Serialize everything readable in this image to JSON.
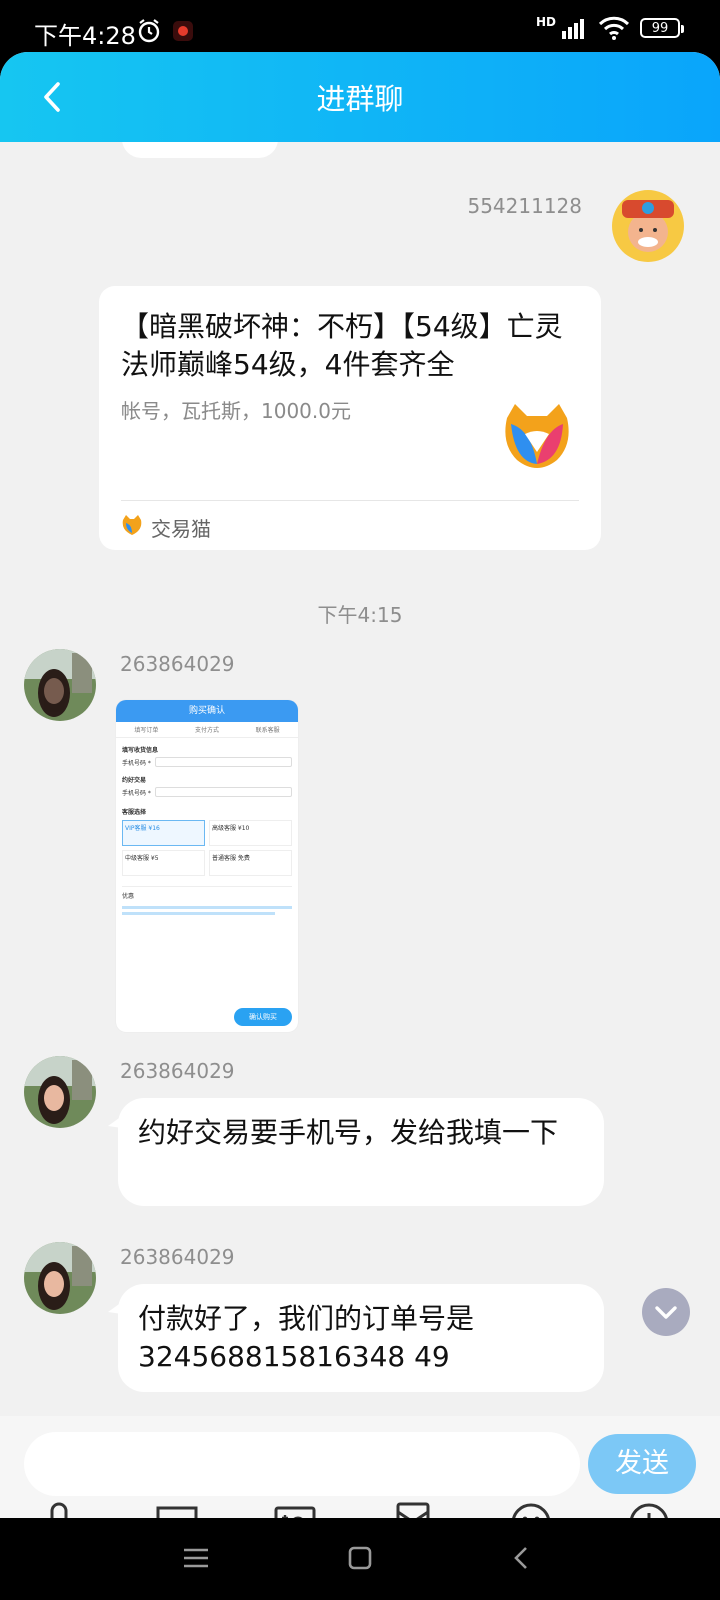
{
  "status": {
    "time": "下午4:28",
    "network": "HD",
    "battery": "99"
  },
  "header": {
    "title": "进群聊"
  },
  "messages": {
    "card_sender": "554211128",
    "card_title": "【暗黑破坏神：不朽】【54级】亡灵法师巅峰54级，4件套齐全",
    "card_subtitle": "帐号，瓦托斯，1000.0元",
    "card_source": "交易猫",
    "timestamp": "下午4:15",
    "sender1": "263864029",
    "sender2": "263864029",
    "sender3": "263864029",
    "bubble2": "约好交易要手机号，发给我填一下",
    "bubble3": "付款好了，我们的订单号是324568815816348 49"
  },
  "screenshot": {
    "title": "购买确认",
    "tab1": "填写订单",
    "tab2": "支付方式",
    "tab3": "联系客服",
    "section1": "填写收货信息",
    "phone_label": "手机号码 *",
    "section2": "约好交易",
    "section3": "客服选择",
    "opt1": "VIP客服 ¥16",
    "opt2": "高级客服 ¥10",
    "opt3": "中级客服 ¥5",
    "opt4": "普通客服 免费",
    "discount": "优惠",
    "confirm": "确认购买"
  },
  "input": {
    "placeholder": "",
    "send_label": "发送"
  },
  "toolbar": [
    "mic-icon",
    "cast-icon",
    "photo-icon",
    "redpacket-icon",
    "emoji-icon",
    "plus-icon"
  ],
  "colors": {
    "header_start": "#16c6f1",
    "header_end": "#0aa5fb",
    "send": "#7cc8f6",
    "chat_bg": "#f1f1f1"
  }
}
